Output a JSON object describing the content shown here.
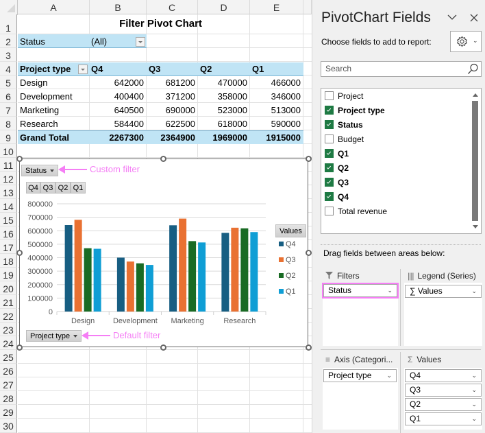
{
  "spreadsheet": {
    "columns": [
      "A",
      "B",
      "C",
      "D",
      "E"
    ],
    "rows": [
      "1",
      "2",
      "3",
      "4",
      "5",
      "6",
      "7",
      "8",
      "9",
      "10",
      "11",
      "12",
      "13",
      "14",
      "15",
      "16",
      "17",
      "18",
      "19",
      "20",
      "21",
      "22",
      "23",
      "24",
      "25",
      "26",
      "27",
      "28",
      "29",
      "30"
    ],
    "title": "Filter Pivot Chart",
    "filter_label": "Status",
    "filter_value": "(All)",
    "pivot": {
      "row_header": "Project type",
      "col_headers": [
        "Q4",
        "Q3",
        "Q2",
        "Q1"
      ],
      "rows": [
        {
          "label": "Design",
          "values": [
            "642000",
            "681200",
            "470000",
            "466000"
          ]
        },
        {
          "label": "Development",
          "values": [
            "400400",
            "371200",
            "358000",
            "346000"
          ]
        },
        {
          "label": "Marketing",
          "values": [
            "640500",
            "690000",
            "523000",
            "513000"
          ]
        },
        {
          "label": "Research",
          "values": [
            "584400",
            "622500",
            "618000",
            "590000"
          ]
        }
      ],
      "total_label": "Grand Total",
      "totals": [
        "2267300",
        "2364900",
        "1969000",
        "1915000"
      ]
    }
  },
  "chart": {
    "status_filter_button": "Status",
    "value_buttons": [
      "Q4",
      "Q3",
      "Q2",
      "Q1"
    ],
    "axis_filter_button": "Project type",
    "legend_title": "Values",
    "annotation_custom": "Custom filter",
    "annotation_default": "Default filter",
    "colors": {
      "Q4": "#175e82",
      "Q3": "#e97132",
      "Q2": "#196b24",
      "Q1": "#0f9ed5",
      "annotation": "#f57ef5"
    }
  },
  "chart_data": {
    "type": "bar",
    "title": "",
    "xlabel": "",
    "ylabel": "",
    "categories": [
      "Design",
      "Development",
      "Marketing",
      "Research"
    ],
    "series": [
      {
        "name": "Q4",
        "values": [
          642000,
          400400,
          640500,
          584400
        ]
      },
      {
        "name": "Q3",
        "values": [
          681200,
          371200,
          690000,
          622500
        ]
      },
      {
        "name": "Q2",
        "values": [
          470000,
          358000,
          523000,
          618000
        ]
      },
      {
        "name": "Q1",
        "values": [
          466000,
          346000,
          513000,
          590000
        ]
      }
    ],
    "ylim": [
      0,
      800000
    ],
    "yticks": [
      "0",
      "100000",
      "200000",
      "300000",
      "400000",
      "500000",
      "600000",
      "700000",
      "800000"
    ],
    "grid": true,
    "legend": "right",
    "legend_title": "Values"
  },
  "panel": {
    "title": "PivotChart Fields",
    "subtitle": "Choose fields to add to report:",
    "search_placeholder": "Search",
    "fields": [
      {
        "label": "Project",
        "checked": false
      },
      {
        "label": "Project type",
        "checked": true
      },
      {
        "label": "Status",
        "checked": true
      },
      {
        "label": "Budget",
        "checked": false
      },
      {
        "label": "Q1",
        "checked": true
      },
      {
        "label": "Q2",
        "checked": true
      },
      {
        "label": "Q3",
        "checked": true
      },
      {
        "label": "Q4",
        "checked": true
      },
      {
        "label": "Total revenue",
        "checked": false
      }
    ],
    "drag_text": "Drag fields between areas below:",
    "areas": {
      "filters": {
        "label": "Filters",
        "items": [
          "Status"
        ]
      },
      "legend": {
        "label": "Legend (Series)",
        "items": [
          "∑ Values"
        ]
      },
      "axis": {
        "label": "Axis (Categori...",
        "items": [
          "Project type"
        ]
      },
      "values": {
        "label": "Values",
        "items": [
          "Q4",
          "Q3",
          "Q2",
          "Q1"
        ]
      }
    }
  }
}
